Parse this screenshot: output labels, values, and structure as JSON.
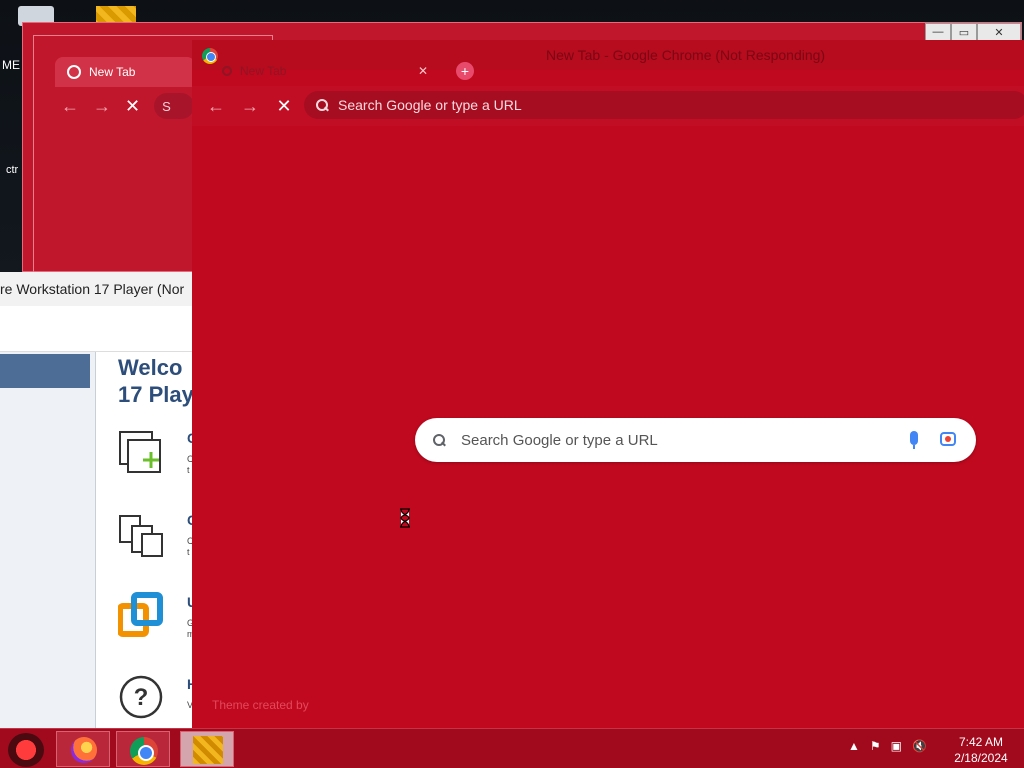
{
  "desktop": {
    "icon_label_1": "ME",
    "icon_label_2": "ctr"
  },
  "back_window": {
    "tab_title": "New Tab",
    "omnibox_text": "S",
    "controls": {
      "minimize": "—",
      "maximize": "▭",
      "close": "✕"
    }
  },
  "vmware": {
    "title": "re Workstation 17 Player (Nor",
    "welcome_line1": "Welco",
    "welcome_line2": "17 Play",
    "items": [
      {
        "title": "C",
        "text": "C\nt"
      },
      {
        "title": "C",
        "text": "C\nt"
      },
      {
        "title": "U",
        "text": "G\nm"
      },
      {
        "title": "H",
        "text": "V"
      }
    ]
  },
  "chrome": {
    "window_title": "New Tab - Google Chrome (Not Responding)",
    "tab_title": "New Tab",
    "tab_close": "✕",
    "new_tab": "+",
    "nav": {
      "back": "←",
      "forward": "→",
      "stop": "✕"
    },
    "omnibox_placeholder": "Search Google or type a URL",
    "ntp_search_placeholder": "Search Google or type a URL",
    "theme_credit": "Theme created by"
  },
  "taskbar": {
    "clock_time": "7:42 AM",
    "clock_date": "2/18/2024",
    "tray": {
      "show_hidden": "▲",
      "flag": "⚑",
      "network": "▣",
      "volume": "🔇"
    }
  },
  "colors": {
    "chrome_bg": "#c0091f",
    "taskbar_bg": "#a1091c",
    "vmware_accent": "#2d4e7a"
  }
}
